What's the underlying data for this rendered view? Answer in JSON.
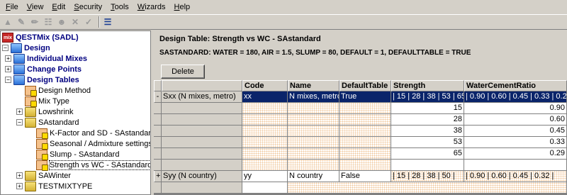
{
  "menu": [
    "File",
    "View",
    "Edit",
    "Security",
    "Tools",
    "Wizards",
    "Help"
  ],
  "menu_underline": [
    "F",
    "V",
    "E",
    "S",
    "T",
    "W",
    "H"
  ],
  "toolbar": {
    "icons": [
      "new-icon",
      "edit-icon",
      "pencil-icon",
      "copy-icon",
      "users-icon",
      "delete-icon",
      "check-icon",
      "tree-view-icon"
    ]
  },
  "tree": {
    "items": [
      {
        "label": "QESTMix (SADL)",
        "bold": true,
        "icon": "app-icon",
        "level": 0,
        "exp": ""
      },
      {
        "label": "Design",
        "bold": true,
        "icon": "folder-icon",
        "level": 0,
        "exp": "−"
      },
      {
        "label": "Individual Mixes",
        "bold": true,
        "icon": "folder-icon",
        "level": 1,
        "exp": "+"
      },
      {
        "label": "Change Points",
        "bold": true,
        "icon": "folder-icon",
        "level": 1,
        "exp": "+"
      },
      {
        "label": "Design Tables",
        "bold": true,
        "icon": "folder-icon",
        "level": 1,
        "exp": "−"
      },
      {
        "label": "Design Method",
        "bold": false,
        "icon": "doc-icon",
        "level": 2,
        "exp": ""
      },
      {
        "label": "Mix Type",
        "bold": false,
        "icon": "doc-icon",
        "level": 2,
        "exp": ""
      },
      {
        "label": "Lowshrink",
        "bold": false,
        "icon": "folder-icon",
        "level": 2,
        "exp": "+"
      },
      {
        "label": "SAstandard",
        "bold": false,
        "icon": "folder-icon",
        "level": 2,
        "exp": "−"
      },
      {
        "label": "K-Factor and SD - SAstandard",
        "bold": false,
        "icon": "doc-icon",
        "level": 3,
        "exp": ""
      },
      {
        "label": "Seasonal / Admixture settings",
        "bold": false,
        "icon": "doc-icon",
        "level": 3,
        "exp": ""
      },
      {
        "label": "Slump - SAstandard",
        "bold": false,
        "icon": "doc-icon",
        "level": 3,
        "exp": ""
      },
      {
        "label": "Strength vs WC - SAstandard",
        "bold": false,
        "icon": "doc-icon",
        "level": 3,
        "exp": "",
        "selected": true
      },
      {
        "label": "SAWinter",
        "bold": false,
        "icon": "folder-icon",
        "level": 2,
        "exp": "+"
      },
      {
        "label": "TESTMIXTYPE",
        "bold": false,
        "icon": "folder-icon",
        "level": 2,
        "exp": "+"
      }
    ]
  },
  "content": {
    "title": "Design Table: Strength vs WC - SAstandard",
    "subtitle": "SASTANDARD: WATER = 180, AIR = 1.5, SLUMP = 80, DEFAULT = 1, DEFAULTTABLE = TRUE",
    "delete_label": "Delete"
  },
  "grid": {
    "columns": [
      "Code",
      "Name",
      "DefaultTable",
      "Strength",
      "WaterCementRatio"
    ],
    "group1": {
      "marker": "-",
      "caption": "Sxx (N mixes, metro)",
      "code": "xx",
      "name": "N mixes, metro",
      "default": "True",
      "strength_summary": "| 15 | 28 | 38 | 53 | 65 |",
      "wcr_summary": "| 0.90 | 0.60 | 0.45 | 0.33 | 0.29 |",
      "rows": [
        {
          "strength": "15",
          "wcr": "0.90"
        },
        {
          "strength": "28",
          "wcr": "0.60"
        },
        {
          "strength": "38",
          "wcr": "0.45"
        },
        {
          "strength": "53",
          "wcr": "0.33"
        },
        {
          "strength": "65",
          "wcr": "0.29"
        }
      ]
    },
    "group2": {
      "marker": "+",
      "caption": "Syy (N country)",
      "code": "yy",
      "name": "N country",
      "default": "False",
      "strength_summary": "| 15 | 28 | 38 | 50 |",
      "wcr_summary": "| 0.90 | 0.60 | 0.45 | 0.32 |"
    }
  }
}
